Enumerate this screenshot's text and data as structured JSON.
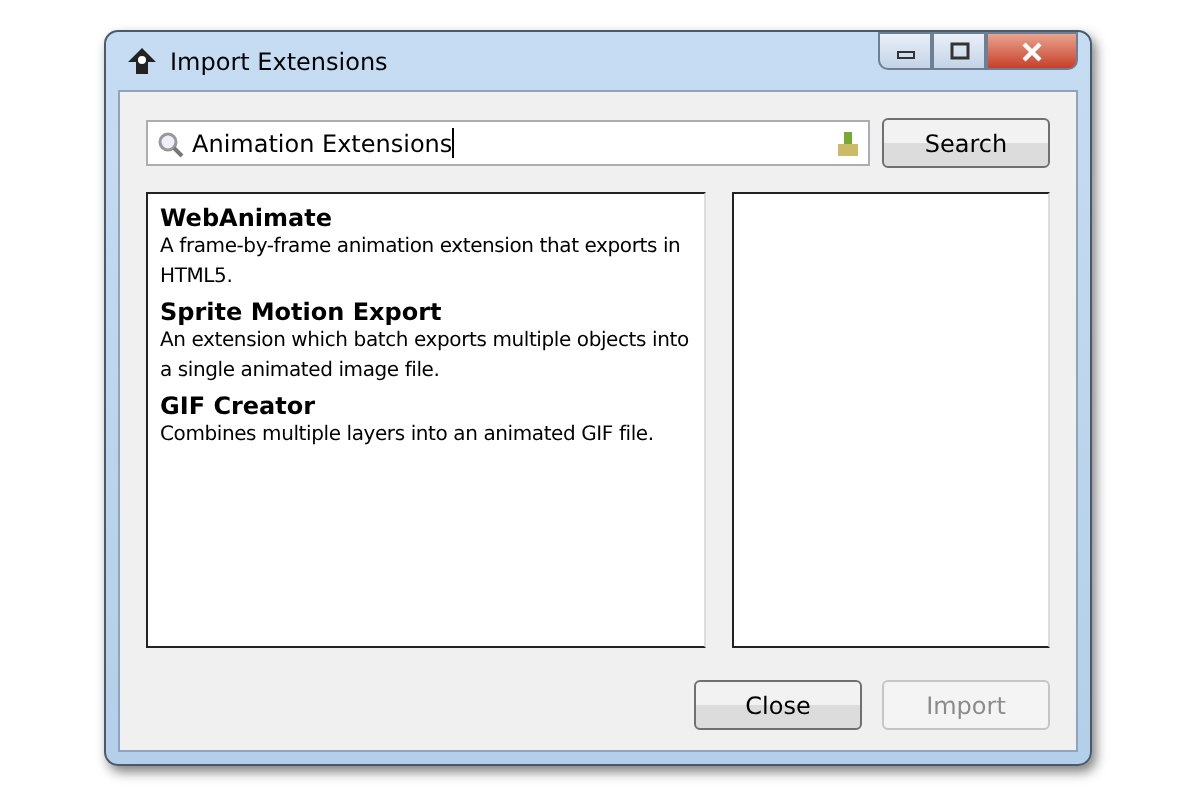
{
  "window": {
    "title": "Import Extensions"
  },
  "search": {
    "value": "Animation Extensions",
    "button": "Search"
  },
  "extensions": [
    {
      "name": "WebAnimate",
      "description": "A frame-by-frame animation extension that exports in HTML5."
    },
    {
      "name": "Sprite Motion Export",
      "description": "An extension which batch exports multiple objects into a single animated image file."
    },
    {
      "name": "GIF Creator",
      "description": "Combines multiple layers into an animated GIF file."
    }
  ],
  "buttons": [
    {
      "label": "Close",
      "disabled": false
    },
    {
      "label": "Import",
      "disabled": true
    }
  ]
}
